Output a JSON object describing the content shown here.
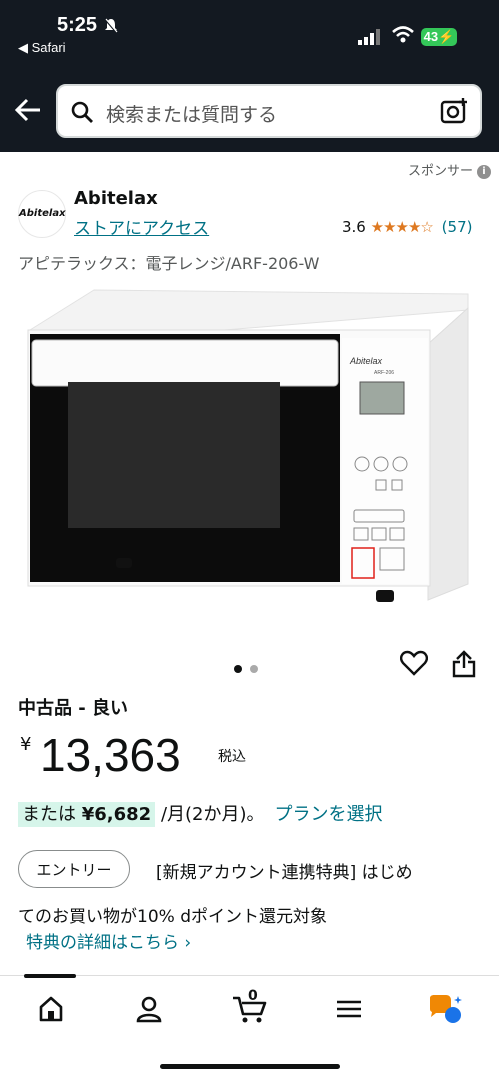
{
  "status": {
    "time": "5:25",
    "back_app": "◀ Safari",
    "battery": "43"
  },
  "search": {
    "placeholder": "検索または質問する"
  },
  "sponsor": {
    "label": "スポンサー",
    "info_glyph": "i"
  },
  "brand": {
    "logo_text": "Abitelax",
    "name": "Abitelax",
    "store_link": "ストアにアクセス",
    "rating_value": "3.6",
    "rating_stars": "★★★★☆",
    "review_count": "(57)"
  },
  "product": {
    "name": "アピテラックス：電子レンジ/ARF-206-W",
    "image_total": 2,
    "image_current": 1,
    "condition": "中古品 - 良い",
    "currency": "¥",
    "price": "13,363",
    "tax_label": "税込",
    "installment_prefix": "または",
    "installment_amount": "¥6,682",
    "installment_suffix": "/月(2か月)。",
    "plan_link": "プランを選択",
    "microwave_brand": "Abitelax",
    "microwave_model": "ARF-206"
  },
  "promo": {
    "entry_button": "エントリー",
    "line1": "[新規アカウント連携特典] はじめ",
    "line2": "てのお買い物が10% dポイント還元対象",
    "details_link": "特典の詳細はこちら ›"
  },
  "nav": {
    "cart_count": "0",
    "items": [
      "home-icon",
      "account-icon",
      "cart-icon",
      "menu-icon",
      "rufus-icon"
    ]
  },
  "colors": {
    "header_bg": "#131921",
    "link": "#007185",
    "star": "#de7921",
    "installment_highlight": "#d6f5ea",
    "battery": "#34c759"
  }
}
